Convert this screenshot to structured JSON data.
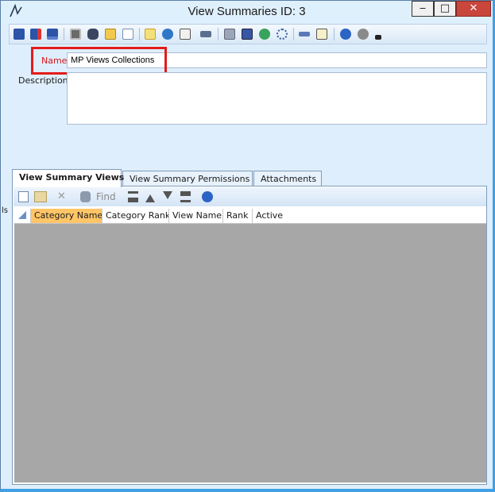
{
  "window": {
    "title": "View Summaries ID: 3",
    "min_glyph": "‒",
    "max_glyph": "□",
    "close_glyph": "✕"
  },
  "toolbar": {
    "icons": [
      "save-icon",
      "save-close-icon",
      "save-new-icon",
      "print-icon",
      "binoculars-icon",
      "open-folder-icon",
      "list-icon",
      "new-record-icon",
      "refresh-icon",
      "id-icon",
      "link-icon",
      "copy-icon",
      "merge-icon",
      "web-icon",
      "circle-icon",
      "import-icon",
      "note-icon",
      "help-icon",
      "info-icon",
      "more-icon"
    ]
  },
  "form": {
    "name_label": "Name",
    "name_value": "MP Views Collections",
    "description_label": "Description",
    "description_value": ""
  },
  "tabs": [
    {
      "label": "View Summary Views",
      "active": true
    },
    {
      "label": "View Summary Permissions",
      "active": false
    },
    {
      "label": "Attachments",
      "active": false
    }
  ],
  "grid_toolbar": {
    "find_label": "Find"
  },
  "grid": {
    "columns": [
      "Category Name",
      "Category Rank",
      "View Name",
      "Rank",
      "Active"
    ],
    "sorted_column": "Category Name"
  },
  "side_text": "ls"
}
